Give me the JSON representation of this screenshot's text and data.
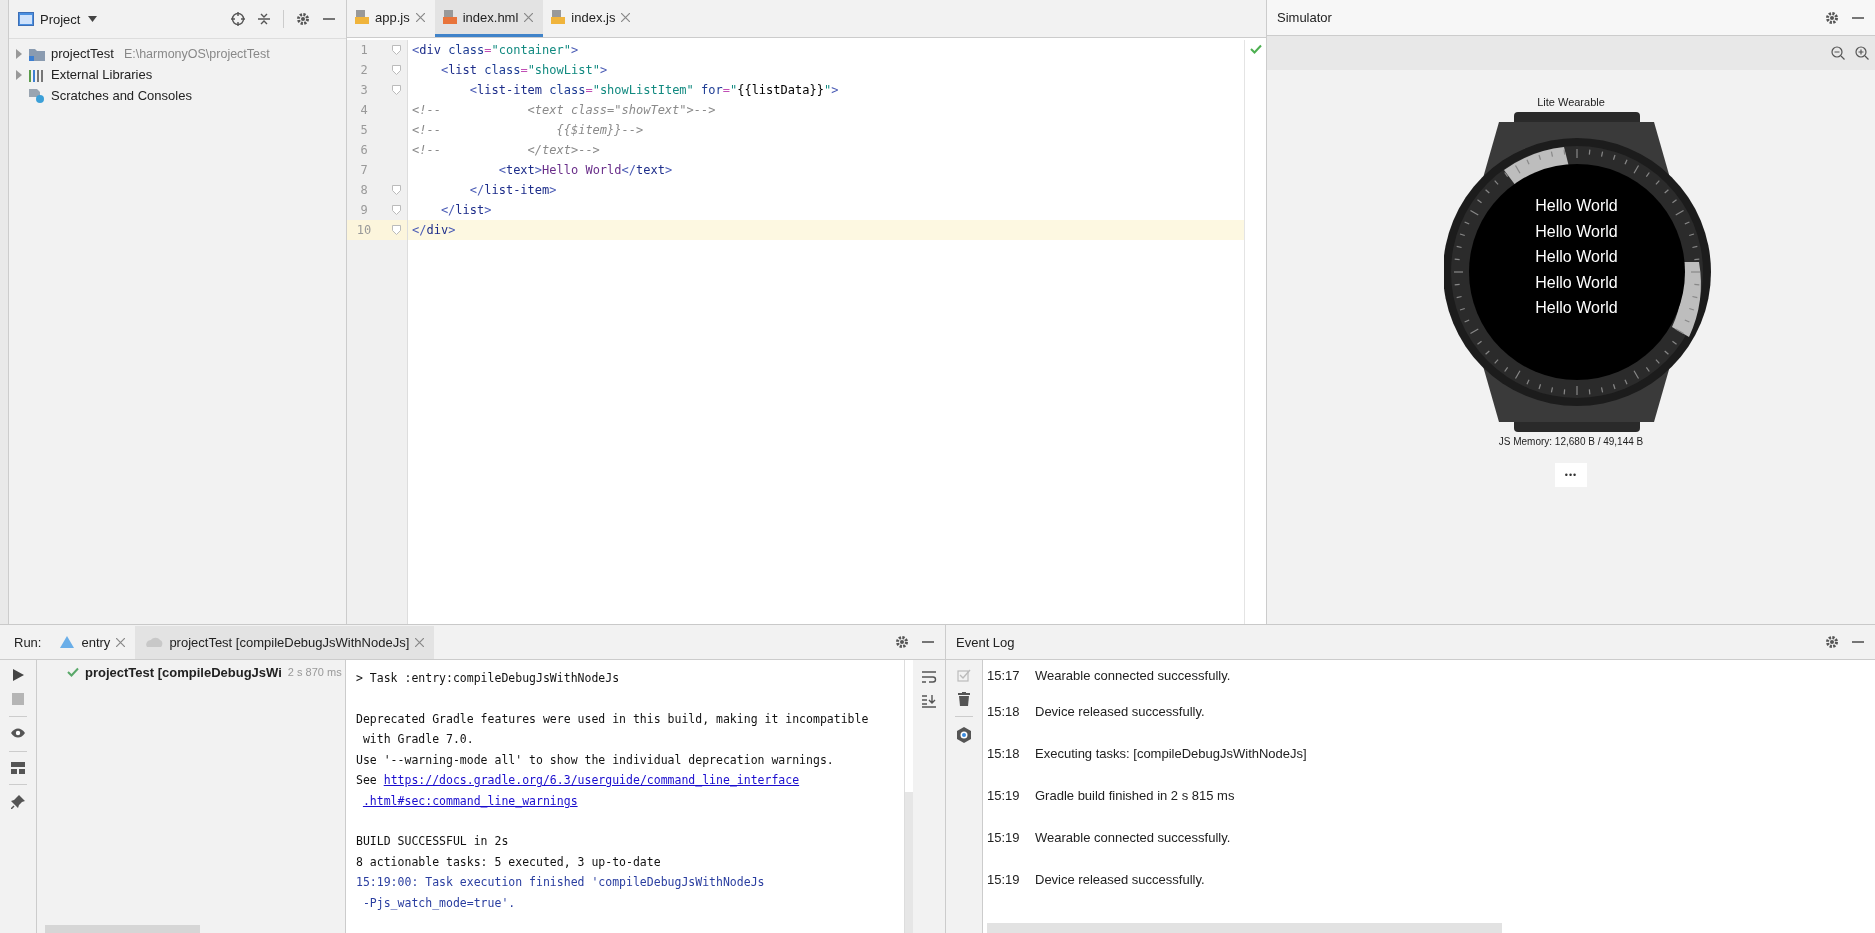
{
  "project_panel": {
    "title": "Project",
    "tree": [
      {
        "label": "projectTest",
        "path": "E:\\harmonyOS\\projectTest",
        "expandable": true
      },
      {
        "label": "External Libraries",
        "expandable": true
      },
      {
        "label": "Scratches and Consoles",
        "expandable": false
      }
    ]
  },
  "editor_tabs": [
    {
      "label": "app.js",
      "selected": false
    },
    {
      "label": "index.hml",
      "selected": true
    },
    {
      "label": "index.js",
      "selected": false
    }
  ],
  "editor": {
    "lines": [
      {
        "number": "1",
        "current": false,
        "fold": true,
        "tokens": [
          {
            "kind": "bracket",
            "text": "<"
          },
          {
            "kind": "tag",
            "text": "div"
          },
          {
            "kind": "attr",
            "text": " class"
          },
          {
            "kind": "eq",
            "text": "="
          },
          {
            "kind": "string",
            "text": "\"container\""
          },
          {
            "kind": "bracket",
            "text": ">"
          }
        ]
      },
      {
        "number": "2",
        "current": false,
        "fold": true,
        "tokens": [
          {
            "kind": "bracket",
            "text": "    <"
          },
          {
            "kind": "tag",
            "text": "list"
          },
          {
            "kind": "attr",
            "text": " class"
          },
          {
            "kind": "eq",
            "text": "="
          },
          {
            "kind": "string",
            "text": "\"showList\""
          },
          {
            "kind": "bracket",
            "text": ">"
          }
        ]
      },
      {
        "number": "3",
        "current": false,
        "fold": true,
        "tokens": [
          {
            "kind": "bracket",
            "text": "        <"
          },
          {
            "kind": "tag",
            "text": "list-item"
          },
          {
            "kind": "attr",
            "text": " class"
          },
          {
            "kind": "eq",
            "text": "="
          },
          {
            "kind": "string",
            "text": "\"showListItem\""
          },
          {
            "kind": "attr",
            "text": " for"
          },
          {
            "kind": "eq",
            "text": "="
          },
          {
            "kind": "string",
            "text": "\""
          },
          {
            "kind": "plain",
            "text": "{{listData}}"
          },
          {
            "kind": "string",
            "text": "\""
          },
          {
            "kind": "bracket",
            "text": ">"
          }
        ]
      },
      {
        "number": "4",
        "current": false,
        "fold": false,
        "tokens": [
          {
            "kind": "comment",
            "text": "<!--            <text class=\"showText\">-->"
          }
        ]
      },
      {
        "number": "5",
        "current": false,
        "fold": false,
        "tokens": [
          {
            "kind": "comment",
            "text": "<!--                {{$item}}-->"
          }
        ]
      },
      {
        "number": "6",
        "current": false,
        "fold": false,
        "tokens": [
          {
            "kind": "comment",
            "text": "<!--            </text>-->"
          }
        ]
      },
      {
        "number": "7",
        "current": false,
        "fold": false,
        "tokens": [
          {
            "kind": "bracket",
            "text": "            <"
          },
          {
            "kind": "tag",
            "text": "text"
          },
          {
            "kind": "bracket",
            "text": ">"
          },
          {
            "kind": "text",
            "text": "Hello World"
          },
          {
            "kind": "bracket",
            "text": "</"
          },
          {
            "kind": "tag",
            "text": "text"
          },
          {
            "kind": "bracket",
            "text": ">"
          }
        ]
      },
      {
        "number": "8",
        "current": false,
        "fold": true,
        "tokens": [
          {
            "kind": "bracket",
            "text": "        </"
          },
          {
            "kind": "tag",
            "text": "list-item"
          },
          {
            "kind": "bracket",
            "text": ">"
          }
        ]
      },
      {
        "number": "9",
        "current": false,
        "fold": true,
        "tokens": [
          {
            "kind": "bracket",
            "text": "    </"
          },
          {
            "kind": "tag",
            "text": "list"
          },
          {
            "kind": "bracket",
            "text": ">"
          }
        ]
      },
      {
        "number": "10",
        "current": true,
        "fold": true,
        "tokens": [
          {
            "kind": "bracket",
            "text": "</"
          },
          {
            "kind": "tag",
            "text": "div"
          },
          {
            "kind": "bracket",
            "text": ">"
          }
        ]
      }
    ]
  },
  "simulator": {
    "title": "Simulator",
    "device_label": "Lite Wearable",
    "screen_lines": [
      "Hello World",
      "Hello World",
      "Hello World",
      "Hello World",
      "Hello World"
    ],
    "memory": "JS Memory: 12,680 B / 49,144 B",
    "more_button": "•••"
  },
  "run_panel": {
    "label": "Run:",
    "tabs": [
      {
        "label": "entry",
        "selected": false
      },
      {
        "label": "projectTest [compileDebugJsWithNodeJs]",
        "selected": true
      }
    ],
    "tree_item": {
      "label": "projectTest [compileDebugJsWi",
      "time": "2 s 870 ms"
    },
    "console": [
      [
        {
          "kind": "normal",
          "text": "> Task :entry:compileDebugJsWithNodeJs"
        }
      ],
      [
        {
          "kind": "normal",
          "text": "Deprecated Gradle features were used in this build, making it incompatible"
        },
        {
          "kind": "normal",
          "text": " with Gradle 7.0."
        },
        {
          "kind": "normal",
          "text": "Use '--warning-mode all' to show the individual deprecation warnings."
        },
        {
          "kind": "link",
          "prefix": "See ",
          "text": "https://docs.gradle.org/6.3/userguide/command_line_interface"
        },
        {
          "kind": "link",
          "text": ".html#sec:command_line_warnings"
        }
      ],
      [
        {
          "kind": "normal",
          "text": "BUILD SUCCESSFUL in 2s"
        },
        {
          "kind": "normal",
          "text": "8 actionable tasks: 5 executed, 3 up-to-date"
        },
        {
          "kind": "info",
          "text": "15:19:00: Task execution finished 'compileDebugJsWithNodeJs"
        },
        {
          "kind": "info",
          "text": " -Pjs_watch_mode=true'."
        }
      ]
    ]
  },
  "event_log": {
    "title": "Event Log",
    "entries": [
      {
        "time": "15:17",
        "message": "Wearable connected successfully."
      },
      {
        "time": "15:18",
        "message": "Device released successfully."
      },
      {
        "time": "15:18",
        "message": "Executing tasks: [compileDebugJsWithNodeJs]"
      },
      {
        "time": "15:19",
        "message": "Gradle build finished in 2 s 815 ms"
      },
      {
        "time": "15:19",
        "message": "Wearable connected successfully."
      },
      {
        "time": "15:19",
        "message": "Device released successfully."
      }
    ]
  }
}
